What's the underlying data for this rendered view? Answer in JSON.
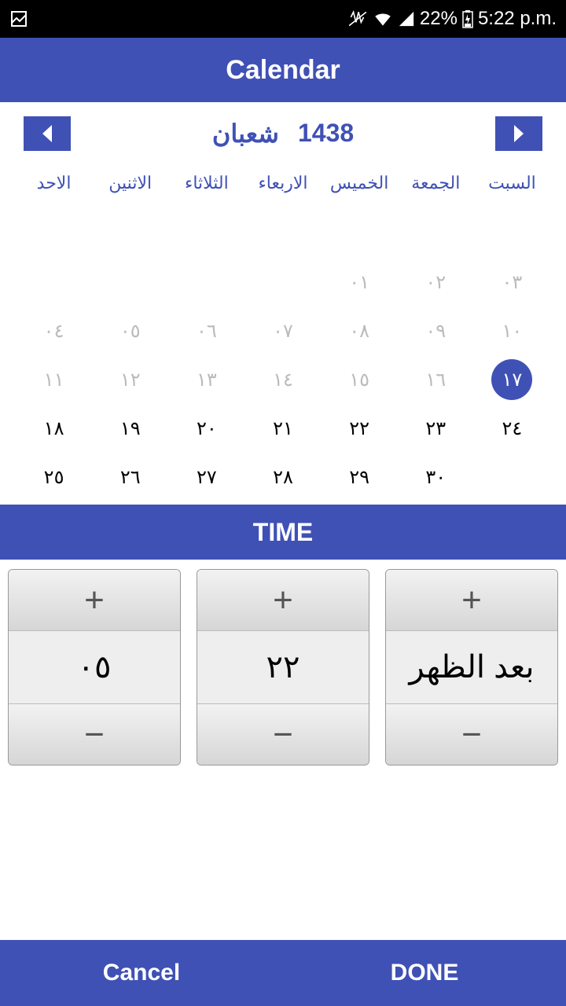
{
  "status": {
    "battery": "22%",
    "time": "5:22 p.m."
  },
  "header": {
    "title": "Calendar"
  },
  "month_nav": {
    "month": "شعبان",
    "year": "1438"
  },
  "weekdays": [
    "الاحد",
    "الاثنين",
    "الثلاثاء",
    "الاربعاء",
    "الخميس",
    "الجمعة",
    "السبت"
  ],
  "days": [
    {
      "t": "",
      "c": ""
    },
    {
      "t": "",
      "c": ""
    },
    {
      "t": "",
      "c": ""
    },
    {
      "t": "",
      "c": ""
    },
    {
      "t": "",
      "c": ""
    },
    {
      "t": "",
      "c": ""
    },
    {
      "t": "",
      "c": ""
    },
    {
      "t": "",
      "c": ""
    },
    {
      "t": "",
      "c": ""
    },
    {
      "t": "",
      "c": ""
    },
    {
      "t": "",
      "c": ""
    },
    {
      "t": "٠١",
      "c": "past"
    },
    {
      "t": "٠٢",
      "c": "past"
    },
    {
      "t": "٠٣",
      "c": "past"
    },
    {
      "t": "٠٤",
      "c": "past"
    },
    {
      "t": "٠٥",
      "c": "past"
    },
    {
      "t": "٠٦",
      "c": "past"
    },
    {
      "t": "٠٧",
      "c": "past"
    },
    {
      "t": "٠٨",
      "c": "past"
    },
    {
      "t": "٠٩",
      "c": "past"
    },
    {
      "t": "١٠",
      "c": "past"
    },
    {
      "t": "١١",
      "c": "past"
    },
    {
      "t": "١٢",
      "c": "past"
    },
    {
      "t": "١٣",
      "c": "past"
    },
    {
      "t": "١٤",
      "c": "past"
    },
    {
      "t": "١٥",
      "c": "past"
    },
    {
      "t": "١٦",
      "c": "past"
    },
    {
      "t": "١٧",
      "c": "selected"
    },
    {
      "t": "١٨",
      "c": "future"
    },
    {
      "t": "١٩",
      "c": "future"
    },
    {
      "t": "٢٠",
      "c": "future"
    },
    {
      "t": "٢١",
      "c": "future"
    },
    {
      "t": "٢٢",
      "c": "future"
    },
    {
      "t": "٢٣",
      "c": "future"
    },
    {
      "t": "٢٤",
      "c": "future"
    },
    {
      "t": "٢٥",
      "c": "future"
    },
    {
      "t": "٢٦",
      "c": "future"
    },
    {
      "t": "٢٧",
      "c": "future"
    },
    {
      "t": "٢٨",
      "c": "future"
    },
    {
      "t": "٢٩",
      "c": "future"
    },
    {
      "t": "٣٠",
      "c": "future"
    },
    {
      "t": "",
      "c": ""
    }
  ],
  "time_header": "TIME",
  "spinners": {
    "hour": "٠٥",
    "minute": "٢٢",
    "ampm": "بعد الظهر"
  },
  "footer": {
    "cancel": "Cancel",
    "done": "DONE"
  }
}
